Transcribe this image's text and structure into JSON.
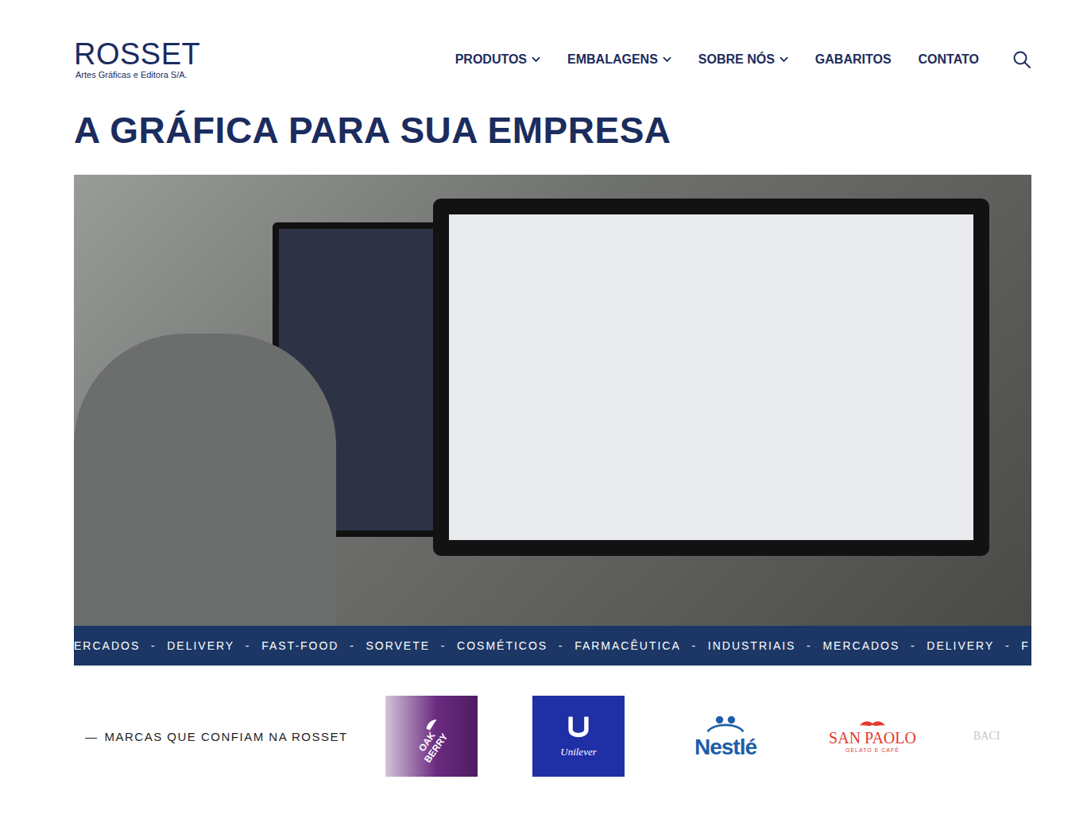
{
  "header": {
    "logo": {
      "name": "ROSSET",
      "tagline": "Artes Gráficas e Editora S/A."
    },
    "nav": [
      {
        "label": "PRODUTOS",
        "dropdown": true
      },
      {
        "label": "EMBALAGENS",
        "dropdown": true
      },
      {
        "label": "SOBRE NÓS",
        "dropdown": true
      },
      {
        "label": "GABARITOS",
        "dropdown": false
      },
      {
        "label": "CONTATO",
        "dropdown": false
      }
    ]
  },
  "hero": {
    "title": "A GRÁFICA PARA SUA EMPRESA"
  },
  "ticker": {
    "separator": "-",
    "items": [
      "ERCADOS",
      "DELIVERY",
      "FAST-FOOD",
      "SORVETE",
      "COSMÉTICOS",
      "FARMACÊUTICA",
      "INDUSTRIAIS",
      "MERCADOS",
      "DELIVERY",
      "F"
    ]
  },
  "brands": {
    "dash": "—",
    "label": "MARCAS QUE CONFIAM NA ROSSET",
    "logos": [
      {
        "name": "OAK BERRY",
        "kind": "oakberry"
      },
      {
        "name": "Unilever",
        "kind": "unilever"
      },
      {
        "name": "Nestlé",
        "kind": "nestle"
      },
      {
        "name": "SAN PAOLO",
        "sub": "GELATO E CAFÉ",
        "kind": "sanpaolo"
      },
      {
        "name": "BACI",
        "kind": "faded"
      }
    ]
  }
}
